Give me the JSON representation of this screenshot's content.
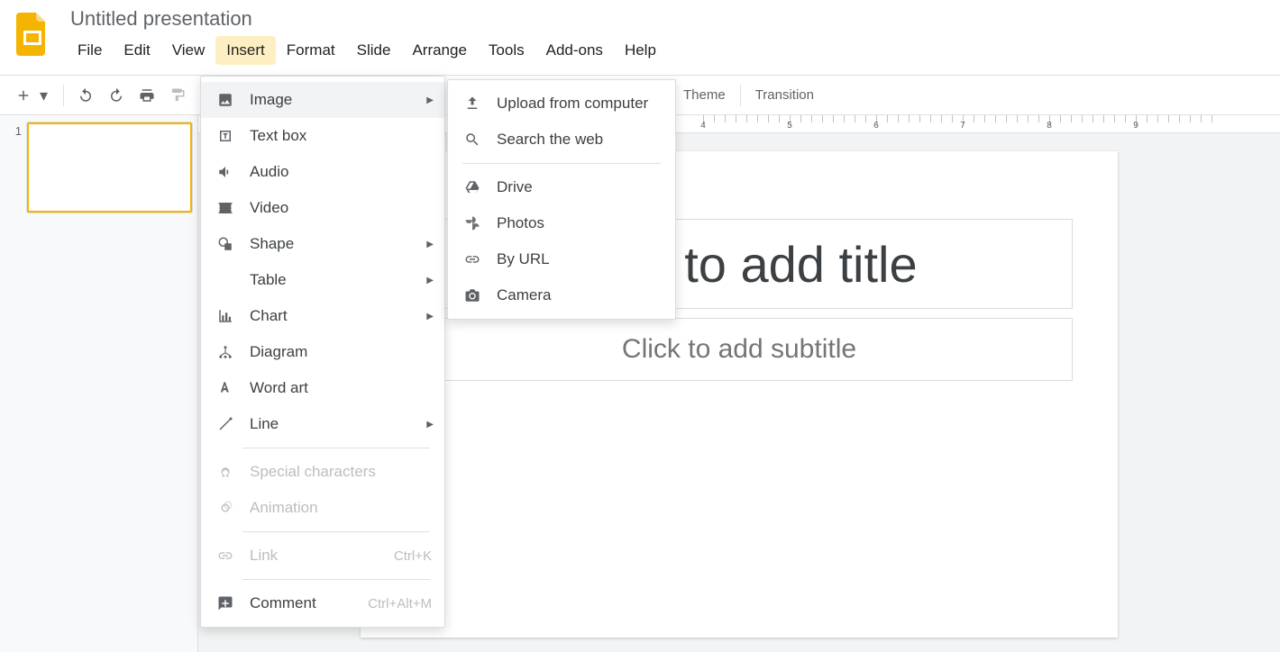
{
  "header": {
    "title": "Untitled presentation",
    "menus": [
      "File",
      "Edit",
      "View",
      "Insert",
      "Format",
      "Slide",
      "Arrange",
      "Tools",
      "Add-ons",
      "Help"
    ],
    "active_menu_index": 3
  },
  "toolbar": {
    "buttons_right": {
      "theme": "Theme",
      "transition": "Transition"
    }
  },
  "insert_menu": {
    "items": [
      {
        "label": "Image",
        "icon": "image-icon",
        "submenu": true,
        "hover": true
      },
      {
        "label": "Text box",
        "icon": "textbox-icon"
      },
      {
        "label": "Audio",
        "icon": "audio-icon"
      },
      {
        "label": "Video",
        "icon": "video-icon"
      },
      {
        "label": "Shape",
        "icon": "shape-icon",
        "submenu": true
      },
      {
        "label": "Table",
        "icon": "",
        "submenu": true
      },
      {
        "label": "Chart",
        "icon": "chart-icon",
        "submenu": true
      },
      {
        "label": "Diagram",
        "icon": "diagram-icon"
      },
      {
        "label": "Word art",
        "icon": "wordart-icon"
      },
      {
        "label": "Line",
        "icon": "line-icon",
        "submenu": true
      },
      {
        "sep": true
      },
      {
        "label": "Special characters",
        "icon": "omega-icon",
        "disabled": true
      },
      {
        "label": "Animation",
        "icon": "animation-icon",
        "disabled": true
      },
      {
        "sep": true
      },
      {
        "label": "Link",
        "icon": "link-icon",
        "disabled": true,
        "shortcut": "Ctrl+K"
      },
      {
        "sep": true
      },
      {
        "label": "Comment",
        "icon": "comment-icon",
        "shortcut": "Ctrl+Alt+M"
      }
    ]
  },
  "image_submenu": {
    "items": [
      {
        "label": "Upload from computer",
        "icon": "upload-icon"
      },
      {
        "label": "Search the web",
        "icon": "search-icon"
      },
      {
        "sep": true
      },
      {
        "label": "Drive",
        "icon": "drive-icon"
      },
      {
        "label": "Photos",
        "icon": "photos-icon"
      },
      {
        "label": "By URL",
        "icon": "url-link-icon"
      },
      {
        "label": "Camera",
        "icon": "camera-icon"
      }
    ]
  },
  "filmstrip": {
    "slides": [
      {
        "number": "1"
      }
    ]
  },
  "canvas": {
    "title_placeholder": "Click to add title",
    "subtitle_placeholder": "Click to add subtitle"
  },
  "ruler": {
    "labels": [
      "4",
      "5",
      "6",
      "7",
      "8",
      "9"
    ]
  }
}
